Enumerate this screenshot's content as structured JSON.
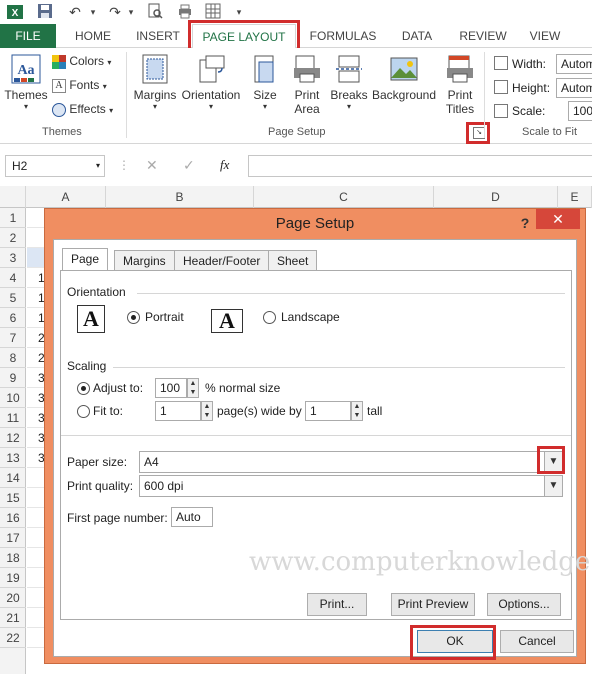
{
  "qat": {
    "icons": [
      "excel-app-icon",
      "save-icon",
      "undo-icon",
      "redo-icon",
      "print-preview-icon",
      "page-layout-icon",
      "customize-qat-icon"
    ]
  },
  "tabs": {
    "file": "FILE",
    "home": "HOME",
    "insert": "INSERT",
    "page_layout": "PAGE LAYOUT",
    "formulas": "FORMULAS",
    "data": "DATA",
    "review": "REVIEW",
    "view": "VIEW"
  },
  "ribbon": {
    "themes": {
      "themes_label": "Themes",
      "colors": "Colors",
      "fonts": "Fonts",
      "effects": "Effects",
      "group_label": "Themes"
    },
    "page_setup": {
      "margins": "Margins",
      "orientation": "Orientation",
      "size": "Size",
      "print_area": "Print Area",
      "breaks": "Breaks",
      "background": "Background",
      "print_titles": "Print Titles",
      "group_label": "Page Setup"
    },
    "scale_to_fit": {
      "width_label": "Width:",
      "width_value": "Autom",
      "height_label": "Height:",
      "height_value": "Autom",
      "scale_label": "Scale:",
      "scale_value": "100",
      "group_label": "Scale to Fit"
    }
  },
  "formula_bar": {
    "name_box": "H2",
    "fx": "fx"
  },
  "sheet": {
    "columns": [
      "A",
      "B",
      "C",
      "D",
      "E"
    ],
    "rows": [
      "1",
      "2",
      "3",
      "4",
      "5",
      "6",
      "7",
      "8",
      "9",
      "10",
      "11",
      "12",
      "13",
      "14",
      "15",
      "16",
      "17",
      "18",
      "19",
      "20",
      "21",
      "22"
    ],
    "colA_values": [
      "",
      "",
      "",
      "1",
      "1",
      "1",
      "2",
      "2",
      "3",
      "3",
      "3",
      "3",
      "3",
      "",
      "",
      "",
      "",
      "",
      "",
      "",
      "",
      ""
    ]
  },
  "dialog": {
    "title": "Page Setup",
    "help": "?",
    "close": "✕",
    "tabs": [
      "Page",
      "Margins",
      "Header/Footer",
      "Sheet"
    ],
    "orientation": {
      "heading": "Orientation",
      "portrait": "Portrait",
      "landscape": "Landscape",
      "selected": "Portrait"
    },
    "scaling": {
      "heading": "Scaling",
      "adjust_to": "Adjust to:",
      "adjust_value": "100",
      "normal_size": "% normal size",
      "fit_to": "Fit to:",
      "fit_wide": "1",
      "pages_wide_by": "page(s) wide by",
      "fit_tall": "1",
      "tall": "tall"
    },
    "paper_size_label": "Paper size:",
    "paper_size_value": "A4",
    "print_quality_label": "Print quality:",
    "print_quality_value": "600 dpi",
    "first_page_label": "First page number:",
    "first_page_value": "Auto",
    "buttons": {
      "print": "Print...",
      "print_preview": "Print Preview",
      "options": "Options...",
      "ok": "OK",
      "cancel": "Cancel"
    }
  },
  "watermark": "www.computerknowledge.net",
  "colors": {
    "excel_green": "#217346",
    "dialog_frame": "#f08e61",
    "highlight_red": "#d12c2c",
    "close_red": "#d6473a"
  }
}
